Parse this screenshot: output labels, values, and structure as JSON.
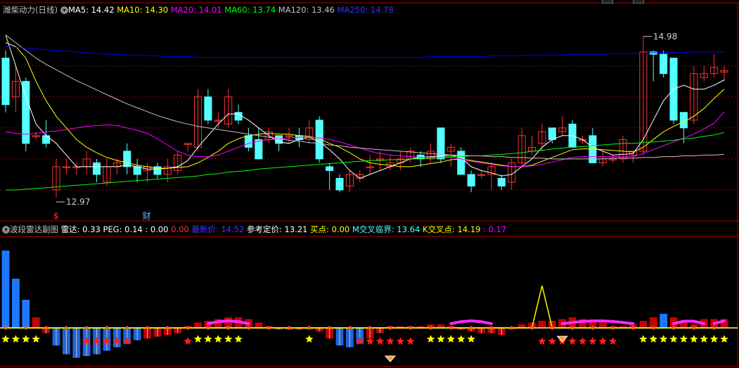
{
  "colors": {
    "up": "#ff3232",
    "down": "#54ffff",
    "ma5": "#ffffff",
    "ma10": "#ffff00",
    "ma20": "#ff00ff",
    "ma60": "#00ff00",
    "ma120": "#c0c0c0",
    "ma250": "#0000ff",
    "grid": "#8b0000"
  },
  "main_header": {
    "stock": "潍柴动力",
    "period": "(日线)",
    "ma5": "MA5: 14.42",
    "ma10": "MA10: 14.30",
    "ma20": "MA20: 14.01",
    "ma60": "MA60: 13.74",
    "ma120": "MA120: 13.46",
    "ma250": "MA250: 14.78"
  },
  "sub_header": {
    "title": "波段雷达副图",
    "radar": "雷达: 0.33",
    "peg": "PEG: 0.14 : 0.00",
    "zero": "0.00",
    "latest": "最新价: 14.52",
    "ref": "参考定价: 13.21",
    "buy": "买点: 0.00",
    "mcross": "M交叉临界: 13.64",
    "kcross": "K交叉点: 14.19",
    "extra": ": 0.17"
  },
  "annotations": {
    "high": "14.98",
    "low": "12.97",
    "s_mark": "$",
    "fin_mark": "财"
  },
  "chart_data": [
    {
      "type": "candlestick",
      "title": "潍柴动力 (日线)",
      "ylim": [
        12.8,
        15.25
      ],
      "ohlc": [
        [
          14.7,
          14.8,
          14.0,
          14.1
        ],
        [
          14.2,
          14.6,
          14.0,
          14.4
        ],
        [
          14.4,
          14.45,
          13.5,
          13.6
        ],
        [
          13.7,
          13.75,
          13.65,
          13.7
        ],
        [
          13.7,
          13.9,
          13.55,
          13.6
        ],
        [
          13.0,
          13.4,
          12.9,
          13.3
        ],
        [
          13.3,
          13.4,
          13.2,
          13.3
        ],
        [
          13.3,
          13.35,
          13.2,
          13.3
        ],
        [
          13.3,
          13.5,
          13.2,
          13.4
        ],
        [
          13.35,
          13.4,
          13.1,
          13.2
        ],
        [
          13.1,
          13.4,
          13.05,
          13.3
        ],
        [
          13.3,
          13.4,
          13.2,
          13.35
        ],
        [
          13.5,
          13.6,
          13.2,
          13.3
        ],
        [
          13.3,
          13.4,
          13.1,
          13.2
        ],
        [
          13.25,
          13.35,
          13.1,
          13.3
        ],
        [
          13.3,
          13.35,
          13.15,
          13.2
        ],
        [
          13.2,
          13.4,
          13.1,
          13.3
        ],
        [
          13.25,
          13.5,
          13.2,
          13.45
        ],
        [
          13.6,
          13.6,
          13.5,
          13.6
        ],
        [
          13.55,
          14.3,
          13.5,
          14.2
        ],
        [
          14.2,
          14.3,
          13.85,
          13.9
        ],
        [
          13.9,
          14.0,
          13.8,
          13.9
        ],
        [
          13.85,
          14.3,
          13.8,
          14.2
        ],
        [
          14.0,
          14.1,
          13.85,
          13.9
        ],
        [
          13.7,
          13.8,
          13.5,
          13.55
        ],
        [
          13.65,
          13.8,
          13.4,
          13.4
        ],
        [
          13.65,
          13.8,
          13.6,
          13.75
        ],
        [
          13.7,
          13.7,
          13.5,
          13.6
        ],
        [
          13.7,
          13.8,
          13.6,
          13.7
        ],
        [
          13.7,
          13.8,
          13.55,
          13.65
        ],
        [
          13.65,
          13.9,
          13.6,
          13.8
        ],
        [
          13.9,
          13.95,
          13.35,
          13.4
        ],
        [
          13.3,
          13.35,
          13.0,
          13.25
        ],
        [
          13.15,
          13.2,
          12.97,
          13.0
        ],
        [
          13.05,
          13.25,
          12.97,
          13.2
        ],
        [
          13.15,
          13.25,
          13.1,
          13.2
        ],
        [
          13.3,
          13.45,
          13.2,
          13.3
        ],
        [
          13.4,
          13.5,
          13.25,
          13.4
        ],
        [
          13.3,
          13.45,
          13.25,
          13.35
        ],
        [
          13.35,
          13.5,
          13.25,
          13.4
        ],
        [
          13.4,
          13.55,
          13.35,
          13.5
        ],
        [
          13.45,
          13.5,
          13.3,
          13.4
        ],
        [
          13.4,
          13.6,
          13.35,
          13.5
        ],
        [
          13.8,
          13.8,
          13.35,
          13.4
        ],
        [
          13.5,
          13.6,
          13.3,
          13.55
        ],
        [
          13.5,
          13.55,
          13.2,
          13.2
        ],
        [
          13.2,
          13.25,
          12.97,
          13.05
        ],
        [
          13.2,
          13.25,
          13.15,
          13.2
        ],
        [
          13.2,
          13.35,
          13.0,
          13.3
        ],
        [
          13.15,
          13.2,
          13.0,
          13.05
        ],
        [
          13.1,
          13.4,
          13.0,
          13.35
        ],
        [
          13.35,
          13.8,
          13.3,
          13.7
        ],
        [
          13.5,
          13.7,
          13.45,
          13.55
        ],
        [
          13.6,
          13.85,
          13.5,
          13.75
        ],
        [
          13.8,
          13.8,
          13.6,
          13.65
        ],
        [
          13.75,
          13.95,
          13.7,
          13.8
        ],
        [
          13.85,
          13.9,
          13.55,
          13.55
        ],
        [
          13.65,
          13.7,
          13.6,
          13.65
        ],
        [
          13.7,
          13.8,
          13.35,
          13.35
        ],
        [
          13.35,
          13.5,
          13.3,
          13.4
        ],
        [
          13.4,
          13.45,
          13.35,
          13.4
        ],
        [
          13.4,
          13.7,
          13.35,
          13.65
        ],
        [
          13.45,
          13.5,
          13.35,
          13.5
        ],
        [
          13.5,
          14.98,
          13.45,
          14.78
        ],
        [
          14.78,
          14.8,
          14.4,
          14.75
        ],
        [
          14.75,
          14.8,
          14.45,
          14.5
        ],
        [
          14.7,
          14.7,
          13.85,
          13.9
        ],
        [
          14.0,
          13.95,
          13.6,
          13.8
        ],
        [
          13.9,
          14.6,
          13.85,
          14.5
        ],
        [
          14.45,
          14.6,
          14.4,
          14.5
        ],
        [
          14.5,
          14.75,
          14.45,
          14.58
        ],
        [
          14.52,
          14.6,
          14.4,
          14.54
        ]
      ],
      "series": [
        {
          "name": "MA5",
          "values": [
            15.0,
            14.6,
            14.2,
            13.85,
            13.7,
            13.6,
            13.45,
            13.3,
            13.3,
            13.3,
            13.3,
            13.3,
            13.32,
            13.3,
            13.27,
            13.27,
            13.28,
            13.3,
            13.38,
            13.55,
            13.7,
            13.85,
            13.98,
            13.98,
            13.9,
            13.8,
            13.7,
            13.62,
            13.6,
            13.65,
            13.68,
            13.62,
            13.52,
            13.4,
            13.25,
            13.15,
            13.2,
            13.25,
            13.3,
            13.35,
            13.4,
            13.42,
            13.43,
            13.44,
            13.45,
            13.42,
            13.3,
            13.25,
            13.22,
            13.18,
            13.2,
            13.3,
            13.4,
            13.55,
            13.65,
            13.7,
            13.7,
            13.65,
            13.55,
            13.5,
            13.45,
            13.46,
            13.47,
            13.65,
            13.9,
            14.15,
            14.3,
            14.35,
            14.3,
            14.3,
            14.35,
            14.42
          ]
        },
        {
          "name": "MA10",
          "values": [
            14.9,
            14.85,
            14.7,
            14.4,
            14.15,
            13.95,
            13.8,
            13.65,
            13.55,
            13.48,
            13.42,
            13.38,
            13.35,
            13.32,
            13.3,
            13.28,
            13.28,
            13.29,
            13.3,
            13.35,
            13.42,
            13.5,
            13.6,
            13.66,
            13.7,
            13.72,
            13.73,
            13.72,
            13.72,
            13.7,
            13.69,
            13.66,
            13.6,
            13.55,
            13.48,
            13.4,
            13.35,
            13.33,
            13.32,
            13.3,
            13.3,
            13.32,
            13.34,
            13.36,
            13.39,
            13.4,
            13.38,
            13.36,
            13.34,
            13.32,
            13.3,
            13.3,
            13.32,
            13.37,
            13.42,
            13.47,
            13.52,
            13.53,
            13.53,
            13.52,
            13.51,
            13.5,
            13.49,
            13.55,
            13.65,
            13.75,
            13.82,
            13.88,
            13.95,
            14.05,
            14.18,
            14.3
          ]
        },
        {
          "name": "MA20",
          "values": [
            13.75,
            13.73,
            13.72,
            13.73,
            13.75,
            13.76,
            13.78,
            13.8,
            13.82,
            13.83,
            13.84,
            13.83,
            13.8,
            13.77,
            13.73,
            13.66,
            13.58,
            13.5,
            13.45,
            13.43,
            13.43,
            13.45,
            13.5,
            13.55,
            13.6,
            13.63,
            13.65,
            13.66,
            13.67,
            13.68,
            13.68,
            13.67,
            13.65,
            13.62,
            13.58,
            13.54,
            13.5,
            13.47,
            13.45,
            13.44,
            13.43,
            13.42,
            13.42,
            13.42,
            13.42,
            13.4,
            13.37,
            13.35,
            13.33,
            13.31,
            13.3,
            13.3,
            13.31,
            13.33,
            13.36,
            13.39,
            13.42,
            13.43,
            13.43,
            13.43,
            13.43,
            13.43,
            13.43,
            13.47,
            13.52,
            13.57,
            13.62,
            13.67,
            13.72,
            13.79,
            13.86,
            14.01
          ]
        },
        {
          "name": "MA60",
          "values": [
            13.0,
            13.0,
            13.01,
            13.02,
            13.03,
            13.04,
            13.05,
            13.06,
            13.07,
            13.08,
            13.09,
            13.1,
            13.11,
            13.12,
            13.13,
            13.14,
            13.15,
            13.16,
            13.17,
            13.18,
            13.2,
            13.21,
            13.23,
            13.24,
            13.25,
            13.27,
            13.28,
            13.29,
            13.3,
            13.31,
            13.32,
            13.33,
            13.34,
            13.35,
            13.36,
            13.37,
            13.38,
            13.38,
            13.39,
            13.39,
            13.4,
            13.4,
            13.41,
            13.42,
            13.43,
            13.43,
            13.44,
            13.44,
            13.45,
            13.46,
            13.47,
            13.48,
            13.5,
            13.51,
            13.53,
            13.54,
            13.55,
            13.56,
            13.57,
            13.58,
            13.59,
            13.6,
            13.6,
            13.61,
            13.62,
            13.63,
            13.64,
            13.66,
            13.67,
            13.69,
            13.71,
            13.74
          ]
        },
        {
          "name": "MA120",
          "values": [
            15.0,
            14.9,
            14.8,
            14.7,
            14.62,
            14.55,
            14.48,
            14.41,
            14.35,
            14.29,
            14.23,
            14.17,
            14.11,
            14.06,
            14.01,
            13.96,
            13.92,
            13.88,
            13.85,
            13.82,
            13.8,
            13.78,
            13.76,
            13.74,
            13.72,
            13.7,
            13.68,
            13.66,
            13.64,
            13.63,
            13.61,
            13.6,
            13.58,
            13.57,
            13.55,
            13.54,
            13.53,
            13.52,
            13.51,
            13.5,
            13.49,
            13.48,
            13.47,
            13.46,
            13.45,
            13.45,
            13.44,
            13.44,
            13.43,
            13.43,
            13.42,
            13.42,
            13.41,
            13.41,
            13.4,
            13.4,
            13.4,
            13.4,
            13.4,
            13.4,
            13.41,
            13.41,
            13.41,
            13.42,
            13.42,
            13.43,
            13.43,
            13.44,
            13.44,
            13.45,
            13.45,
            13.46
          ]
        },
        {
          "name": "MA250",
          "values": [
            14.85,
            14.84,
            14.83,
            14.82,
            14.81,
            14.8,
            14.79,
            14.78,
            14.77,
            14.76,
            14.75,
            14.75,
            14.74,
            14.74,
            14.73,
            14.73,
            14.72,
            14.72,
            14.72,
            14.71,
            14.71,
            14.71,
            14.71,
            14.71,
            14.71,
            14.71,
            14.71,
            14.71,
            14.71,
            14.71,
            14.71,
            14.71,
            14.71,
            14.71,
            14.71,
            14.71,
            14.71,
            14.71,
            14.71,
            14.71,
            14.71,
            14.71,
            14.72,
            14.72,
            14.72,
            14.72,
            14.72,
            14.72,
            14.73,
            14.73,
            14.73,
            14.73,
            14.74,
            14.74,
            14.74,
            14.74,
            14.75,
            14.75,
            14.75,
            14.75,
            14.76,
            14.76,
            14.76,
            14.76,
            14.77,
            14.77,
            14.77,
            14.77,
            14.78,
            14.78,
            14.78,
            14.78
          ]
        }
      ]
    },
    {
      "type": "bar",
      "title": "波段雷达副图",
      "ylim": [
        -1.0,
        2.5
      ],
      "values": [
        2.2,
        1.4,
        0.8,
        0.3,
        -0.15,
        -0.5,
        -0.75,
        -0.85,
        -0.8,
        -0.75,
        -0.65,
        -0.55,
        -0.45,
        -0.35,
        -0.3,
        -0.25,
        -0.2,
        -0.15,
        0.05,
        0.15,
        0.2,
        0.25,
        0.3,
        0.3,
        0.25,
        0.15,
        0.05,
        -0.05,
        -0.05,
        -0.05,
        0.0,
        -0.1,
        -0.3,
        -0.5,
        -0.55,
        -0.45,
        -0.3,
        -0.15,
        0.05,
        0.05,
        0.05,
        0.05,
        0.1,
        0.1,
        0.05,
        -0.05,
        -0.1,
        -0.15,
        -0.15,
        -0.2,
        0.0,
        0.1,
        0.15,
        0.2,
        0.2,
        0.25,
        0.3,
        0.25,
        0.2,
        0.15,
        0.05,
        0.05,
        0.1,
        0.2,
        0.3,
        0.4,
        0.3,
        0.2,
        0.1,
        0.25,
        0.25,
        0.25
      ],
      "signal_line": [
        0,
        0,
        0,
        0,
        0,
        0,
        0,
        0,
        0,
        0,
        0,
        0,
        0,
        0,
        0,
        0,
        0,
        0,
        0,
        0,
        0,
        0,
        0,
        0,
        0,
        0,
        0,
        0,
        0,
        0,
        0,
        0,
        0,
        0,
        0,
        0,
        0,
        0,
        0,
        0,
        0,
        0,
        0,
        0,
        0,
        0,
        0,
        0,
        0,
        0,
        0,
        0,
        0,
        1.2,
        0,
        0,
        0,
        0,
        0,
        0,
        0,
        0,
        0,
        0,
        0,
        0,
        0,
        0,
        0,
        0,
        0,
        0
      ],
      "stars": [
        "Y",
        "Y",
        "Y",
        "Y",
        "",
        "",
        "",
        "",
        "R",
        "R",
        "R",
        "R",
        "R",
        "",
        "",
        "",
        "",
        "",
        "R",
        "Y",
        "Y",
        "Y",
        "Y",
        "Y",
        "",
        "",
        "",
        "",
        "",
        "",
        "Y",
        "",
        "",
        "",
        "",
        "R",
        "R",
        "R",
        "R",
        "R",
        "R",
        "",
        "Y",
        "Y",
        "Y",
        "Y",
        "Y",
        "",
        "",
        "",
        "",
        "",
        "",
        "R",
        "R",
        "R",
        "R",
        "R",
        "R",
        "R",
        "R",
        "",
        "",
        "Y",
        "Y",
        "Y",
        "Y",
        "Y",
        "Y",
        "Y",
        "Y",
        "Y"
      ]
    }
  ]
}
